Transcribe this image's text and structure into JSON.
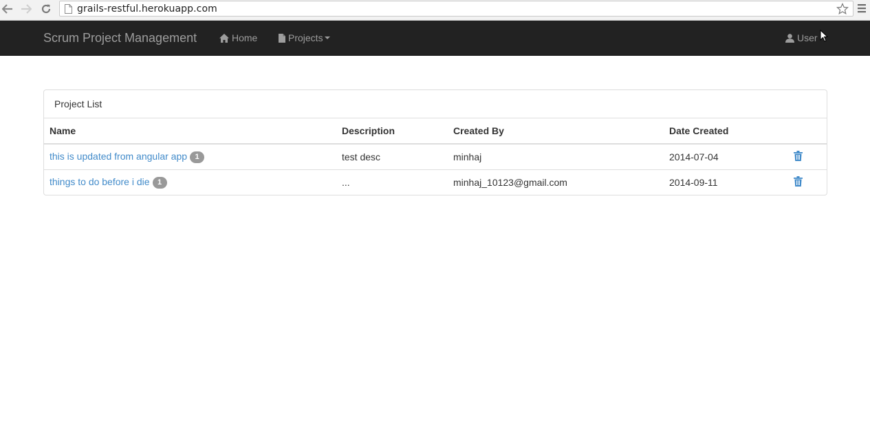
{
  "browser": {
    "url": "grails-restful.herokuapp.com"
  },
  "navbar": {
    "brand": "Scrum Project Management",
    "home_label": "Home",
    "projects_label": "Projects",
    "user_label": "User"
  },
  "panel": {
    "title": "Project List",
    "columns": [
      "Name",
      "Description",
      "Created By",
      "Date Created"
    ],
    "rows": [
      {
        "name": "this is updated from angular app",
        "badge": "1",
        "description": "test desc",
        "created_by": "minhaj",
        "date_created": "2014-07-04"
      },
      {
        "name": "things to do before i die",
        "badge": "1",
        "description": "...",
        "created_by": "minhaj_10123@gmail.com",
        "date_created": "2014-09-11"
      }
    ]
  },
  "colors": {
    "navbar_bg": "#222222",
    "navbar_text": "#9d9d9d",
    "link": "#428bca",
    "badge_bg": "#999999",
    "border": "#dddddd"
  },
  "icons": {
    "back": "arrow-left-icon",
    "forward": "arrow-right-icon",
    "reload": "reload-icon",
    "page": "page-icon",
    "bookmark": "star-icon",
    "menu": "hamburger-menu-icon",
    "home": "home-icon",
    "projects": "file-icon",
    "user": "user-icon",
    "delete": "trash-icon",
    "cursor": "mouse-cursor-icon"
  }
}
